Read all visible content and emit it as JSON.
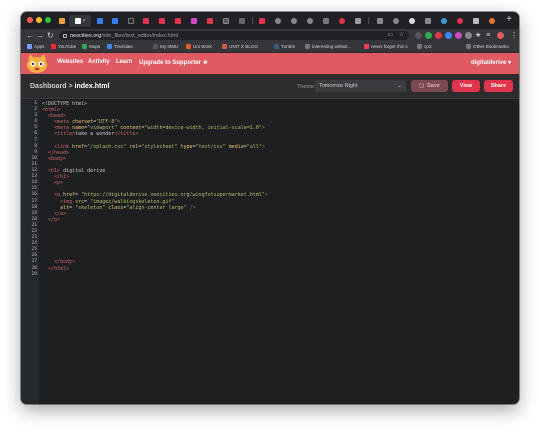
{
  "browser": {
    "url_host": "neocities.org",
    "url_path": "/site_files/text_editor/index.html",
    "tab_close": "×"
  },
  "bookmarks": [
    {
      "label": "Apps",
      "color": "#7aa0ff"
    },
    {
      "label": "YouTube",
      "color": "#ff2a2a"
    },
    {
      "label": "Maps",
      "color": "#34a853"
    },
    {
      "label": "Translate",
      "color": "#4285f4"
    },
    {
      "label": "My MMU",
      "color": "#555555"
    },
    {
      "label": "Uni Work",
      "color": "#e85d2b"
    },
    {
      "label": "UNIT X BLOG",
      "color": "#d05a4a"
    },
    {
      "label": "Tumblr",
      "color": "#3a5a80"
    },
    {
      "label": "interesting websit...",
      "color": "#777777"
    },
    {
      "label": "never forget this s",
      "color": "#ff3b5c"
    },
    {
      "label": "cp3",
      "color": "#777777"
    },
    {
      "label": "Other Bookmarks",
      "color": "#777777"
    }
  ],
  "site_nav": {
    "links": [
      "Websites",
      "Activity",
      "Learn",
      "Upgrade to Supporter ★"
    ],
    "username": "digitalderive ▾",
    "accent": "#e05a62"
  },
  "editor_header": {
    "breadcrumb_root": "Dashboard",
    "breadcrumb_sep": " > ",
    "filename": "index.html",
    "theme_label": "Theme:",
    "theme_value": "Tomorrow Night",
    "save_label": "Save",
    "view_label": "View",
    "share_label": "Share"
  },
  "code_lines": [
    [
      [
        "doc",
        "<!DOCTYPE html>"
      ]
    ],
    [
      [
        "tag",
        "<html>"
      ]
    ],
    [
      [
        "txt",
        "  "
      ],
      [
        "tag",
        "<head>"
      ]
    ],
    [
      [
        "txt",
        "    "
      ],
      [
        "tag",
        "<meta "
      ],
      [
        "attr",
        "charset"
      ],
      [
        "txt",
        "="
      ],
      [
        "str",
        "\"UTF-8\""
      ],
      [
        "tag",
        ">"
      ]
    ],
    [
      [
        "txt",
        "    "
      ],
      [
        "tag",
        "<meta "
      ],
      [
        "attr",
        "name"
      ],
      [
        "txt",
        "="
      ],
      [
        "str",
        "\"viewport\""
      ],
      [
        "txt",
        " "
      ],
      [
        "attr",
        "content"
      ],
      [
        "txt",
        "="
      ],
      [
        "str",
        "\"width=device-width, initial-scale=1.0\""
      ],
      [
        "tag",
        ">"
      ]
    ],
    [
      [
        "txt",
        "    "
      ],
      [
        "tag",
        "<title>"
      ],
      [
        "txt",
        "take a wonder"
      ],
      [
        "tag",
        "</title>"
      ]
    ],
    [],
    [
      [
        "txt",
        "    "
      ],
      [
        "tag",
        "<link "
      ],
      [
        "attr",
        "href"
      ],
      [
        "txt",
        "="
      ],
      [
        "str",
        "\"/splash.css\""
      ],
      [
        "txt",
        " "
      ],
      [
        "attr",
        "rel"
      ],
      [
        "txt",
        "="
      ],
      [
        "str",
        "\"stylesheet\""
      ],
      [
        "txt",
        " "
      ],
      [
        "attr",
        "type"
      ],
      [
        "txt",
        "="
      ],
      [
        "str",
        "\"text/css\""
      ],
      [
        "txt",
        " "
      ],
      [
        "attr",
        "media"
      ],
      [
        "txt",
        "="
      ],
      [
        "str",
        "\"all\""
      ],
      [
        "tag",
        ">"
      ]
    ],
    [
      [
        "txt",
        "  "
      ],
      [
        "tag",
        "</head>"
      ]
    ],
    [
      [
        "txt",
        "  "
      ],
      [
        "tag",
        "<body>"
      ]
    ],
    [],
    [
      [
        "txt",
        "  "
      ],
      [
        "tag",
        "<h1>"
      ],
      [
        "txt",
        " digital dérive"
      ]
    ],
    [
      [
        "txt",
        "    "
      ],
      [
        "tag",
        "</h1>"
      ]
    ],
    [
      [
        "txt",
        "    "
      ],
      [
        "tag",
        "<p>"
      ]
    ],
    [],
    [
      [
        "txt",
        "    "
      ],
      [
        "tag",
        "<a "
      ],
      [
        "attr",
        "href"
      ],
      [
        "txt",
        "= "
      ],
      [
        "str",
        "\"https://digitalderive.neocities.org/wingfotsupermarket.html\""
      ],
      [
        "tag",
        ">"
      ]
    ],
    [
      [
        "txt",
        "      "
      ],
      [
        "tag",
        "<img "
      ],
      [
        "attr",
        "src"
      ],
      [
        "txt",
        "= "
      ],
      [
        "str",
        "\"images/walkingskeleton.gif\""
      ]
    ],
    [
      [
        "txt",
        "      "
      ],
      [
        "attr",
        "alt"
      ],
      [
        "txt",
        "= "
      ],
      [
        "str",
        "\"skeleton\""
      ],
      [
        "txt",
        " "
      ],
      [
        "attr",
        "class"
      ],
      [
        "txt",
        "="
      ],
      [
        "str",
        "\"align-center large\""
      ],
      [
        "txt",
        " "
      ],
      [
        "tag",
        "/>"
      ]
    ],
    [
      [
        "txt",
        "    "
      ],
      [
        "tag",
        "</a>"
      ]
    ],
    [
      [
        "txt",
        "  "
      ],
      [
        "tag",
        "</p>"
      ]
    ],
    [],
    [],
    [],
    [],
    [],
    [],
    [
      [
        "txt",
        "    "
      ],
      [
        "tag",
        "</body>"
      ]
    ],
    [
      [
        "txt",
        "  "
      ],
      [
        "tag",
        "</html>"
      ]
    ],
    []
  ]
}
